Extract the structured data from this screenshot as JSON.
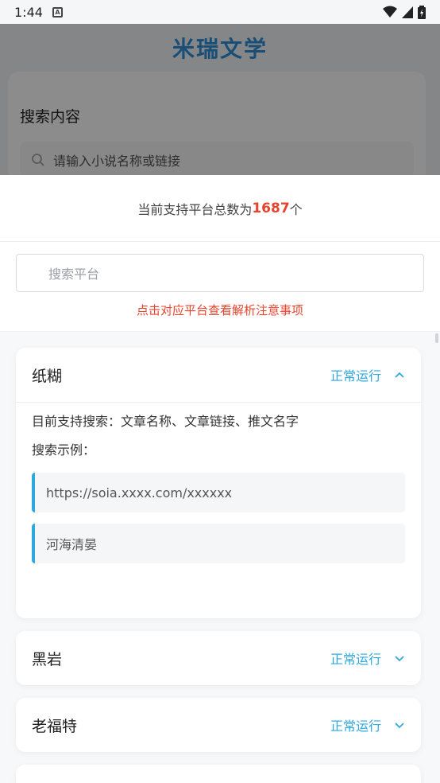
{
  "status_bar": {
    "time": "1:44",
    "notification_badge": "A"
  },
  "background": {
    "app_title": "米瑞文学",
    "search_label": "搜索内容",
    "search_placeholder": "请输入小说名称或链接"
  },
  "sheet": {
    "header_prefix": "当前支持平台总数为",
    "header_count": "1687",
    "header_suffix": "个",
    "search_placeholder": "搜索平台",
    "hint": "点击对应平台查看解析注意事项"
  },
  "platforms": [
    {
      "name": "纸糊",
      "status": "正常运行",
      "expanded": true,
      "support_line": "目前支持搜索：文章名称、文章链接、推文名字",
      "example_label": "搜索示例：",
      "examples": [
        "https://soia.xxxx.com/xxxxxx",
        "河海清晏"
      ]
    },
    {
      "name": "黑岩",
      "status": "正常运行",
      "expanded": false
    },
    {
      "name": "老福特",
      "status": "正常运行",
      "expanded": false
    }
  ],
  "colors": {
    "accent": "#2fa8e0",
    "count": "#e8432d",
    "title": "#2f8fd8"
  }
}
